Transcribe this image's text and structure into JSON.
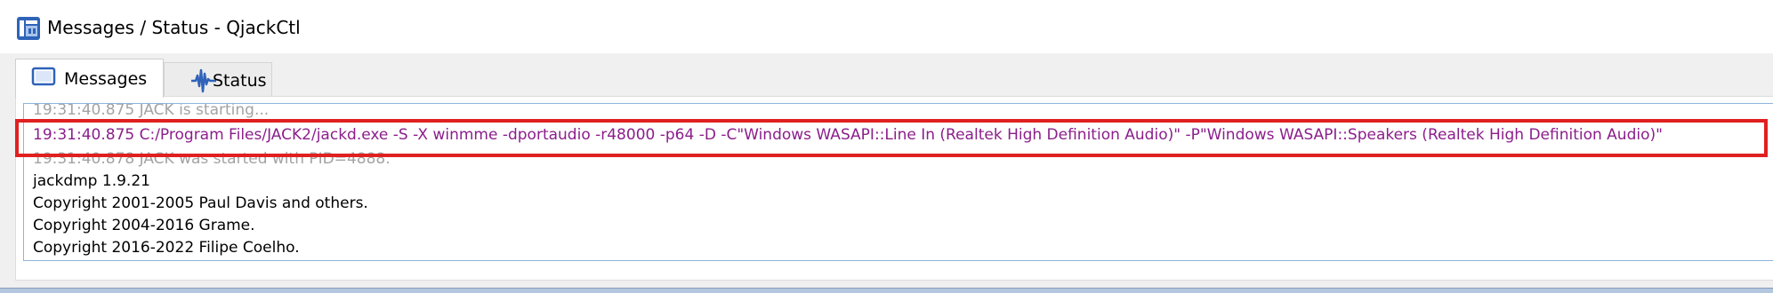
{
  "window": {
    "title": "Messages / Status - QjackCtl",
    "app_icon": "qjackctl-icon"
  },
  "tabs": [
    {
      "label": "Messages",
      "icon": "messages-icon",
      "active": true
    },
    {
      "label": "Status",
      "icon": "waveform-icon",
      "active": false
    }
  ],
  "log": {
    "lines": [
      {
        "text": "19:31:40.875 JACK is starting...",
        "style": "faded"
      },
      {
        "text": "19:31:40.875 C:/Program Files/JACK2/jackd.exe -S -X winmme -dportaudio -r48000 -p64 -D -C\"Windows WASAPI::Line In (Realtek High Definition Audio)\" -P\"Windows WASAPI::Speakers (Realtek High Definition Audio)\"",
        "style": "command",
        "highlighted": true
      },
      {
        "text": "19:31:40.878 JACK was started with PID=4888.",
        "style": "faded"
      },
      {
        "text": "jackdmp 1.9.21",
        "style": "normal"
      },
      {
        "text": "Copyright 2001-2005 Paul Davis and others.",
        "style": "normal"
      },
      {
        "text": "Copyright 2004-2016 Grame.",
        "style": "normal"
      },
      {
        "text": "Copyright 2016-2022 Filipe Coelho.",
        "style": "normal"
      }
    ]
  },
  "colors": {
    "command_text": "#8b1e8b",
    "faded_text": "#a3a3a3",
    "highlight_border": "#e02020",
    "log_border": "#8fb4dc"
  }
}
